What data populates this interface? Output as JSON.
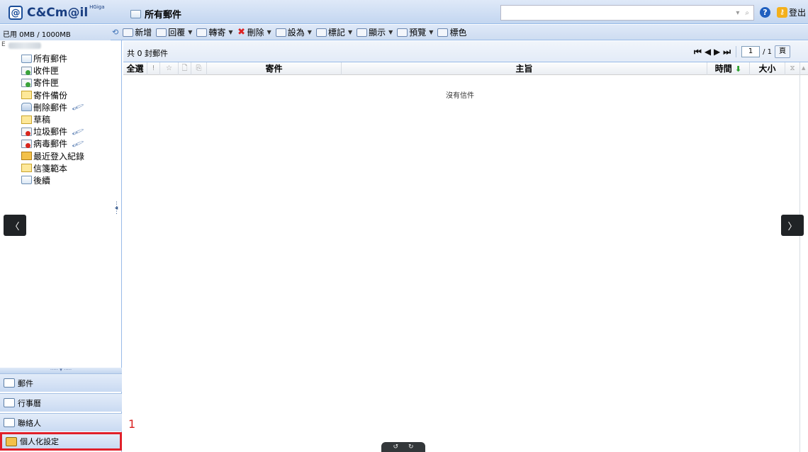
{
  "header": {
    "logo_text": "C&Cm@il",
    "logo_sup": "HGiga",
    "folder_title": "所有郵件",
    "logout_label": "登出",
    "search_dropdown_glyph": "▾",
    "search_glyph": "⌕",
    "help_glyph": "?"
  },
  "quota": {
    "text": "已用 0MB / 1000MB"
  },
  "toolbar": {
    "items": [
      {
        "label": "新增"
      },
      {
        "label": "回覆"
      },
      {
        "label": "轉寄"
      },
      {
        "label": "刪除"
      },
      {
        "label": "設為"
      },
      {
        "label": "標記"
      },
      {
        "label": "顯示"
      },
      {
        "label": "預覽"
      },
      {
        "label": "標色"
      }
    ]
  },
  "sidebar": {
    "account_initial": "E",
    "folders": [
      {
        "label": "所有郵件"
      },
      {
        "label": "收件匣"
      },
      {
        "label": "寄件匣"
      },
      {
        "label": "寄件備份"
      },
      {
        "label": "刪除郵件"
      },
      {
        "label": "草稿"
      },
      {
        "label": "垃圾郵件"
      },
      {
        "label": "病毒郵件"
      },
      {
        "label": "最近登入紀錄"
      },
      {
        "label": "信箋範本"
      },
      {
        "label": "後續"
      }
    ],
    "nav": [
      {
        "label": "郵件"
      },
      {
        "label": "行事曆"
      },
      {
        "label": "聯絡人"
      },
      {
        "label": "個人化設定"
      }
    ],
    "marker": "1"
  },
  "main": {
    "count_text": "共 0 封郵件",
    "pager": {
      "page": "1",
      "total": "/ 1",
      "go_label": "頁"
    },
    "columns": {
      "select_all": "全選",
      "priority": "!",
      "star": "☆",
      "sender": "寄件",
      "subject": "主旨",
      "time": "時間",
      "size": "大小"
    },
    "empty_text": "沒有信件"
  },
  "overlay": {
    "prev": "〈",
    "next": "〉"
  }
}
